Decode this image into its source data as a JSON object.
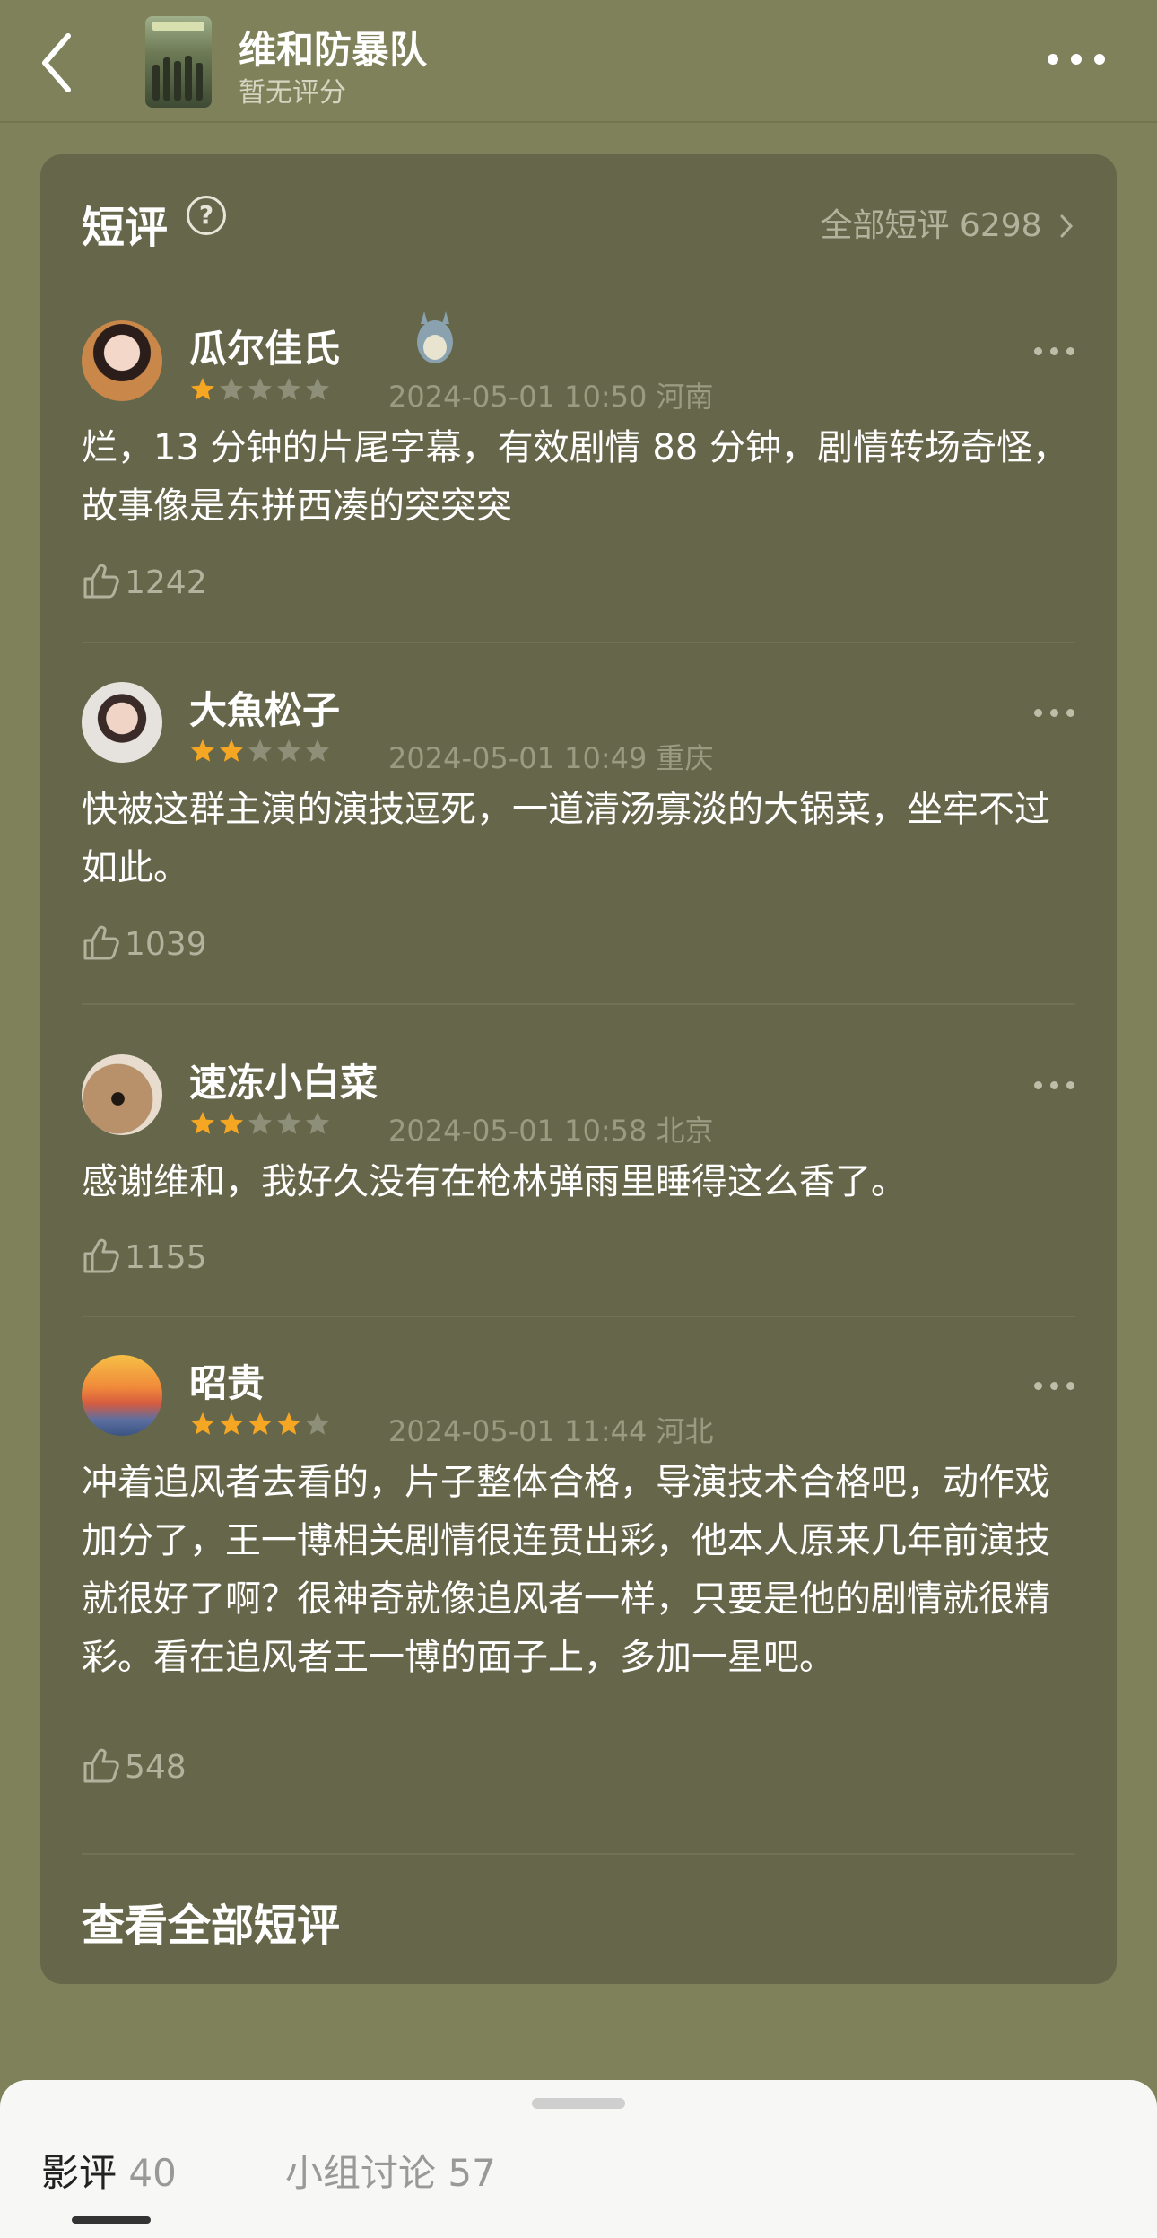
{
  "header": {
    "movie_title": "维和防暴队",
    "movie_subtitle": "暂无评分"
  },
  "colors": {
    "background": "#7e8159",
    "card": "#66674a",
    "star_filled": "#f5a623",
    "star_empty": "#8e8f78"
  },
  "short_reviews": {
    "title": "短评",
    "all_link": "全部短评 6298",
    "view_all": "查看全部短评",
    "items": [
      {
        "user": "瓜尔佳氏",
        "rating": 1,
        "meta": "2024-05-01 10:50 河南",
        "text": "烂，13 分钟的片尾字幕，有效剧情 88 分钟，剧情转场奇怪，故事像是东拼西凑的突突突",
        "likes": "1242"
      },
      {
        "user": "大魚松子",
        "rating": 2,
        "meta": "2024-05-01 10:49 重庆",
        "text": "快被这群主演的演技逗死，一道清汤寡淡的大锅菜，坐牢不过如此。",
        "likes": "1039"
      },
      {
        "user": "速冻小白菜",
        "rating": 2,
        "meta": "2024-05-01 10:58 北京",
        "text": "感谢维和，我好久没有在枪林弹雨里睡得这么香了。",
        "likes": "1155"
      },
      {
        "user": "昭贵",
        "rating": 4,
        "meta": "2024-05-01 11:44 河北",
        "text": "冲着追风者去看的，片子整体合格，导演技术合格吧，动作戏加分了，王一博相关剧情很连贯出彩，他本人原来几年前演技就很好了啊？很神奇就像追风者一样，只要是他的剧情就很精彩。看在追风者王一博的面子上，多加一星吧。",
        "likes": "548"
      }
    ]
  },
  "bottom_tabs": [
    {
      "label": "影评",
      "count": "40"
    },
    {
      "label": "小组讨论",
      "count": "57"
    }
  ]
}
